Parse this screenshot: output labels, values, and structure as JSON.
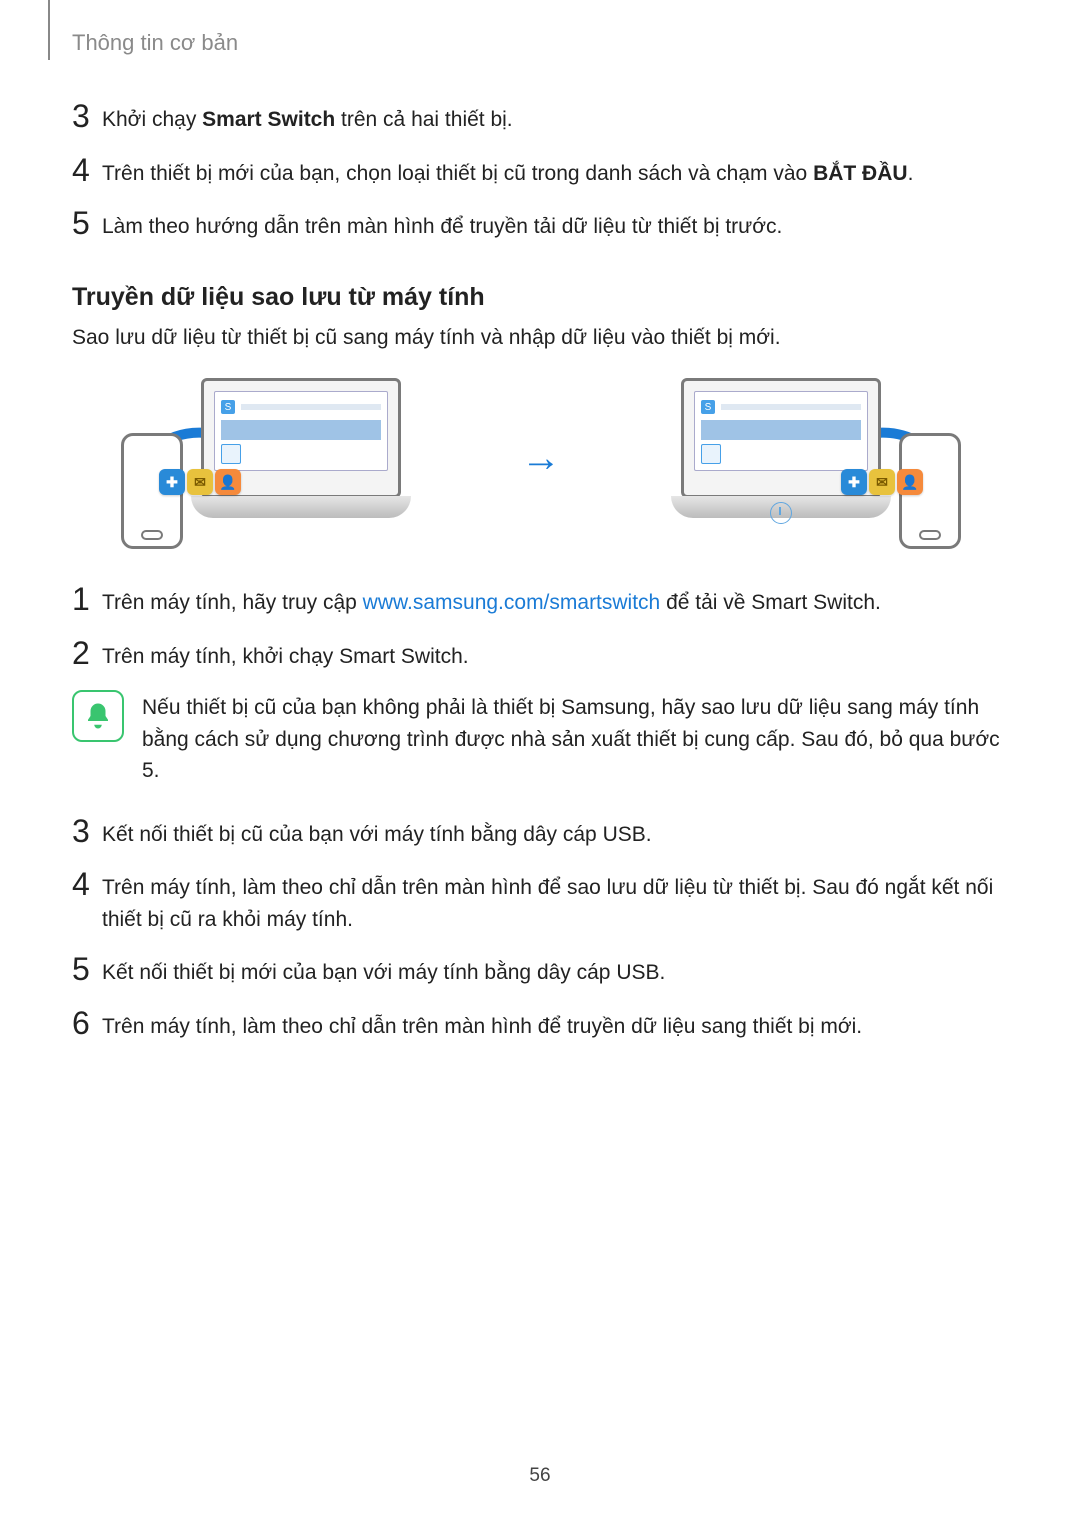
{
  "header": {
    "title": "Thông tin cơ bản"
  },
  "top_steps": [
    {
      "num": "3",
      "prefix": "Khởi chạy ",
      "strong": "Smart Switch",
      "suffix": " trên cả hai thiết bị."
    },
    {
      "num": "4",
      "prefix": "Trên thiết bị mới của bạn, chọn loại thiết bị cũ trong danh sách và chạm vào ",
      "strong": "BẮT ĐẦU",
      "suffix": "."
    },
    {
      "num": "5",
      "prefix": "Làm theo hướng dẫn trên màn hình để truyền tải dữ liệu từ thiết bị trước.",
      "strong": "",
      "suffix": ""
    }
  ],
  "section": {
    "title": "Truyền dữ liệu sao lưu từ máy tính",
    "intro": "Sao lưu dữ liệu từ thiết bị cũ sang máy tính và nhập dữ liệu vào thiết bị mới."
  },
  "illustration": {
    "left_alt": "backup-from-old-phone-to-pc",
    "right_alt": "restore-from-pc-to-new-phone",
    "arrow": "→"
  },
  "bottom_steps": {
    "s1": {
      "num": "1",
      "pre": "Trên máy tính, hãy truy cập ",
      "link": "www.samsung.com/smartswitch",
      "post": " để tải về Smart Switch."
    },
    "s2": {
      "num": "2",
      "text": "Trên máy tính, khởi chạy Smart Switch."
    },
    "note": {
      "text": "Nếu thiết bị cũ của bạn không phải là thiết bị Samsung, hãy sao lưu dữ liệu sang máy tính bằng cách sử dụng chương trình được nhà sản xuất thiết bị cung cấp. Sau đó, bỏ qua bước 5."
    },
    "s3": {
      "num": "3",
      "text": "Kết nối thiết bị cũ của bạn với máy tính bằng dây cáp USB."
    },
    "s4": {
      "num": "4",
      "text": "Trên máy tính, làm theo chỉ dẫn trên màn hình để sao lưu dữ liệu từ thiết bị. Sau đó ngắt kết nối thiết bị cũ ra khỏi máy tính."
    },
    "s5": {
      "num": "5",
      "text": "Kết nối thiết bị mới của bạn với máy tính bằng dây cáp USB."
    },
    "s6": {
      "num": "6",
      "text": "Trên máy tính, làm theo chỉ dẫn trên màn hình để truyền dữ liệu sang thiết bị mới."
    }
  },
  "page_number": "56",
  "icons": {
    "app_s": "S"
  }
}
